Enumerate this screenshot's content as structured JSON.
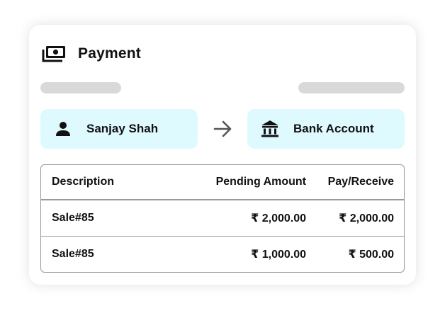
{
  "header": {
    "title": "Payment",
    "icon": "money-icon"
  },
  "transfer": {
    "from": {
      "name": "Sanjay Shah",
      "icon": "person-icon"
    },
    "to": {
      "name": "Bank Account",
      "icon": "bank-icon"
    },
    "arrow_icon": "arrow-right-icon",
    "accent_bg": "#dffaff"
  },
  "table": {
    "columns": [
      "Description",
      "Pending Amount",
      "Pay/Receive"
    ],
    "rows": [
      {
        "description": "Sale#85",
        "pending": "₹ 2,000.00",
        "pay": "₹ 2,000.00"
      },
      {
        "description": "Sale#85",
        "pending": "₹ 1,000.00",
        "pay": "₹ 500.00"
      }
    ]
  }
}
